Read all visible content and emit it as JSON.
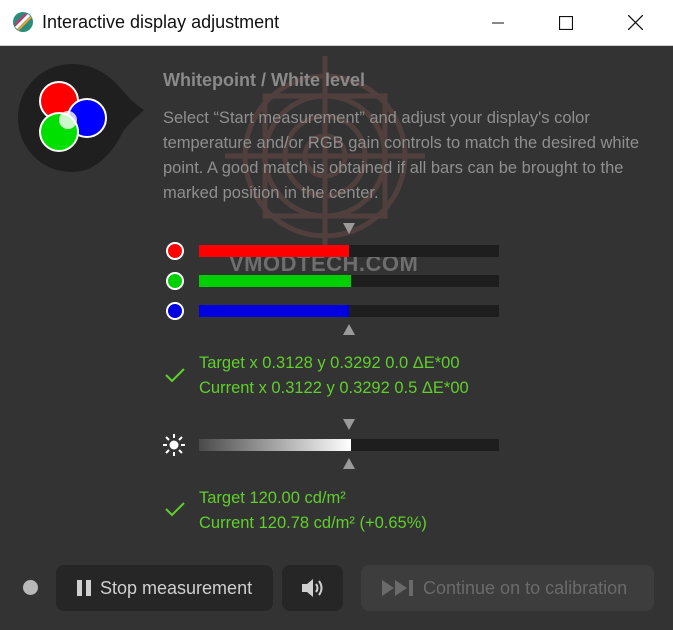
{
  "window": {
    "title": "Interactive display adjustment"
  },
  "header": {
    "title": "Whitepoint / White level",
    "description": "Select “Start measurement” and adjust your display's color temperature and/or RGB gain controls to match the desired white point. A good match is obtained if all bars can be brought to the marked position in the center."
  },
  "rgb_bars": [
    {
      "channel": "red",
      "color": "#ff0000",
      "level": 0.5
    },
    {
      "channel": "green",
      "color": "#00d000",
      "level": 0.505
    },
    {
      "channel": "blue",
      "color": "#0000e0",
      "level": 0.5
    }
  ],
  "whitepoint_status": {
    "target": "Target x 0.3128 y 0.3292 0.0 ΔE*00",
    "current": "Current x 0.3122 y 0.3292 0.5 ΔE*00"
  },
  "luminance_bar": {
    "level": 0.505
  },
  "luminance_status": {
    "target": "Target 120.00 cd/m²",
    "current": "Current 120.78 cd/m² (+0.65%)"
  },
  "buttons": {
    "stop_label": "Stop measurement",
    "continue_label": "Continue on to calibration"
  },
  "watermark_text": "VMODTECH.COM",
  "colors": {
    "background": "#333333",
    "status_green": "#5fcf2a"
  }
}
